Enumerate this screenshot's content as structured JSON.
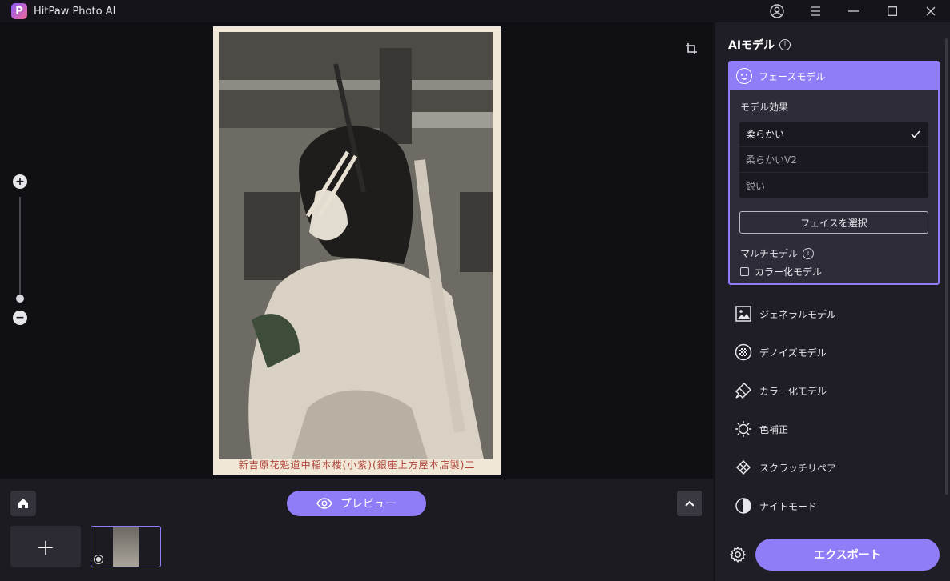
{
  "app": {
    "logo_letter": "P",
    "title": "HitPaw Photo AI"
  },
  "window_controls": [
    "account-icon",
    "menu-icon",
    "minimize-icon",
    "maximize-icon",
    "close-icon"
  ],
  "canvas": {
    "photo_caption": "新吉原花魁道中稲本楼(小紫)(銀座上方屋本店製)二"
  },
  "bottom": {
    "preview_label": "プレビュー",
    "add_symbol": "+"
  },
  "panel": {
    "title": "AIモデル",
    "face_model": {
      "title": "フェースモデル",
      "effect_label": "モデル効果",
      "effects": [
        {
          "label": "柔らかい",
          "selected": true
        },
        {
          "label": "柔らかいV2",
          "selected": false
        },
        {
          "label": "鋭い",
          "selected": false
        }
      ],
      "select_face_label": "フェイスを選択",
      "multi_label": "マルチモデル",
      "colorize_check_label": "カラー化モデル"
    },
    "models": [
      {
        "label": "ジェネラルモデル",
        "icon": "image-icon"
      },
      {
        "label": "デノイズモデル",
        "icon": "denoise-icon"
      },
      {
        "label": "カラー化モデル",
        "icon": "brush-icon"
      },
      {
        "label": "色補正",
        "icon": "sun-icon"
      },
      {
        "label": "スクラッチリペア",
        "icon": "bandage-icon"
      },
      {
        "label": "ナイトモード",
        "icon": "contrast-icon"
      }
    ],
    "export_label": "エクスポート"
  },
  "colors": {
    "accent": "#8f7cf7",
    "background": "#15141a",
    "panel": "#1f1e26"
  }
}
